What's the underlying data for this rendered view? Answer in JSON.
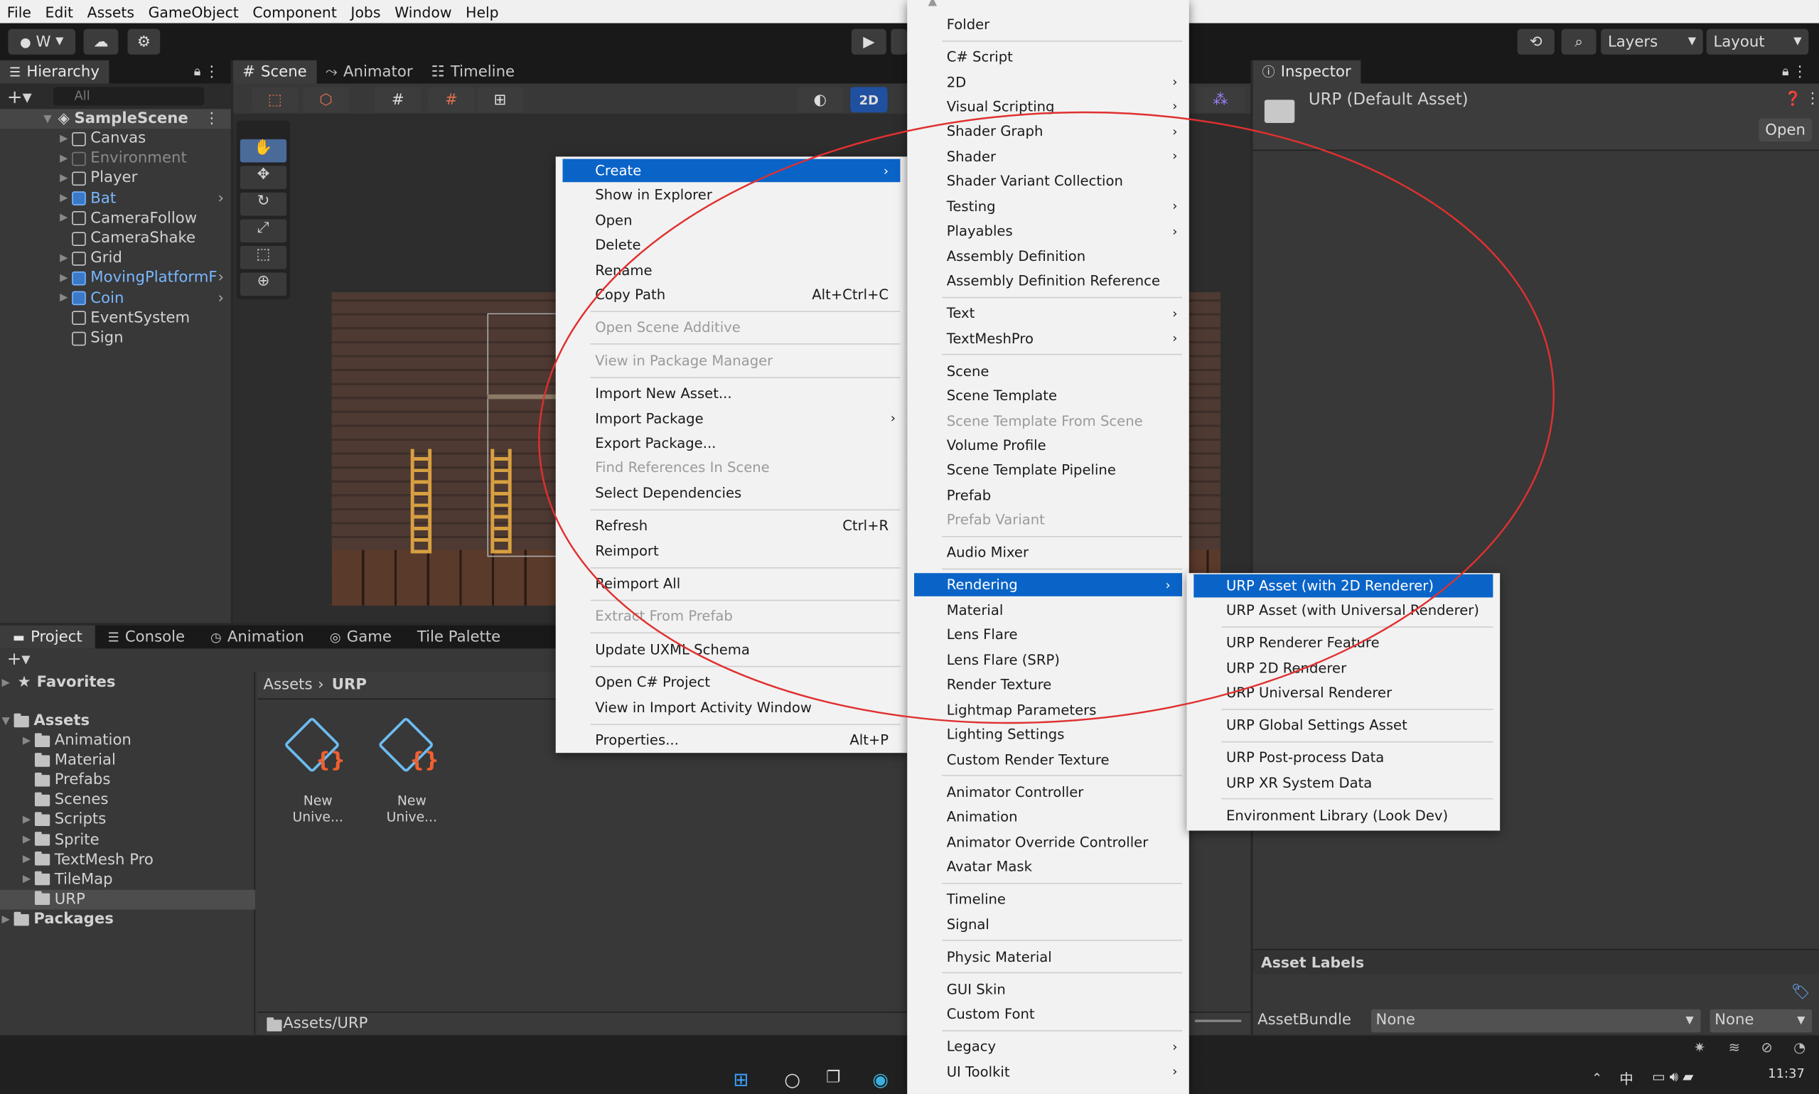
{
  "menubar": [
    "File",
    "Edit",
    "Assets",
    "GameObject",
    "Component",
    "Jobs",
    "Window",
    "Help"
  ],
  "toolbar": {
    "account": "W",
    "layers": "Layers",
    "layout": "Layout"
  },
  "hierarchy": {
    "tab": "Hierarchy",
    "search_placeholder": "All",
    "scene": "SampleScene",
    "items": [
      {
        "label": "Canvas",
        "style": "normal",
        "expand": true
      },
      {
        "label": "Environment",
        "style": "dim",
        "expand": true
      },
      {
        "label": "Player",
        "style": "normal",
        "expand": true
      },
      {
        "label": "Bat",
        "style": "prefab",
        "expand": true,
        "more": true
      },
      {
        "label": "CameraFollow",
        "style": "normal",
        "expand": true
      },
      {
        "label": "CameraShake",
        "style": "normal",
        "expand": false
      },
      {
        "label": "Grid",
        "style": "normal",
        "expand": true
      },
      {
        "label": "MovingPlatformF",
        "style": "prefab",
        "expand": true,
        "more": true
      },
      {
        "label": "Coin",
        "style": "prefab",
        "expand": true,
        "more": true
      },
      {
        "label": "EventSystem",
        "style": "normal",
        "expand": false
      },
      {
        "label": "Sign",
        "style": "normal",
        "expand": false
      }
    ]
  },
  "scene_tabs": [
    "Scene",
    "Animator",
    "Timeline"
  ],
  "scene_toolbar": {
    "mode2d": "2D"
  },
  "bottom_tabs": [
    "Project",
    "Console",
    "Animation",
    "Game",
    "Tile Palette"
  ],
  "project": {
    "favorites": "Favorites",
    "assets": "Assets",
    "folders": [
      "Animation",
      "Material",
      "Prefabs",
      "Scenes",
      "Scripts",
      "Sprite",
      "TextMesh Pro",
      "TileMap",
      "URP"
    ],
    "packages": "Packages",
    "breadcrumb": [
      "Assets",
      "URP"
    ],
    "files": [
      "New Unive...",
      "New Unive..."
    ],
    "footer": "Assets/URP"
  },
  "inspector": {
    "tab": "Inspector",
    "title": "URP (Default Asset)",
    "open": "Open",
    "asset_labels": "Asset Labels",
    "assetbundle": "AssetBundle",
    "ab_value": "None",
    "ab_variant": "None"
  },
  "context_menu": [
    {
      "label": "Create",
      "hl": true,
      "arrow": true
    },
    {
      "label": "Show in Explorer"
    },
    {
      "label": "Open"
    },
    {
      "label": "Delete"
    },
    {
      "label": "Rename"
    },
    {
      "label": "Copy Path",
      "shortcut": "Alt+Ctrl+C"
    },
    {
      "sep": true
    },
    {
      "label": "Open Scene Additive",
      "dis": true
    },
    {
      "sep": true
    },
    {
      "label": "View in Package Manager",
      "dis": true
    },
    {
      "sep": true
    },
    {
      "label": "Import New Asset..."
    },
    {
      "label": "Import Package",
      "arrow": true
    },
    {
      "label": "Export Package..."
    },
    {
      "label": "Find References In Scene",
      "dis": true
    },
    {
      "label": "Select Dependencies"
    },
    {
      "sep": true
    },
    {
      "label": "Refresh",
      "shortcut": "Ctrl+R"
    },
    {
      "label": "Reimport"
    },
    {
      "sep": true
    },
    {
      "label": "Reimport All"
    },
    {
      "sep": true
    },
    {
      "label": "Extract From Prefab",
      "dis": true
    },
    {
      "sep": true
    },
    {
      "label": "Update UXML Schema"
    },
    {
      "sep": true
    },
    {
      "label": "Open C# Project"
    },
    {
      "label": "View in Import Activity Window"
    },
    {
      "sep": true
    },
    {
      "label": "Properties...",
      "shortcut": "Alt+P"
    }
  ],
  "create_menu": [
    {
      "label": "Folder"
    },
    {
      "sep": true
    },
    {
      "label": "C# Script"
    },
    {
      "label": "2D",
      "arrow": true
    },
    {
      "label": "Visual Scripting",
      "arrow": true
    },
    {
      "label": "Shader Graph",
      "arrow": true
    },
    {
      "label": "Shader",
      "arrow": true
    },
    {
      "label": "Shader Variant Collection"
    },
    {
      "label": "Testing",
      "arrow": true
    },
    {
      "label": "Playables",
      "arrow": true
    },
    {
      "label": "Assembly Definition"
    },
    {
      "label": "Assembly Definition Reference"
    },
    {
      "sep": true
    },
    {
      "label": "Text",
      "arrow": true
    },
    {
      "label": "TextMeshPro",
      "arrow": true
    },
    {
      "sep": true
    },
    {
      "label": "Scene"
    },
    {
      "label": "Scene Template"
    },
    {
      "label": "Scene Template From Scene",
      "dis": true
    },
    {
      "label": "Volume Profile"
    },
    {
      "label": "Scene Template Pipeline"
    },
    {
      "label": "Prefab"
    },
    {
      "label": "Prefab Variant",
      "dis": true
    },
    {
      "sep": true
    },
    {
      "label": "Audio Mixer"
    },
    {
      "sep": true
    },
    {
      "label": "Rendering",
      "hl": true,
      "arrow": true
    },
    {
      "label": "Material"
    },
    {
      "label": "Lens Flare"
    },
    {
      "label": "Lens Flare (SRP)"
    },
    {
      "label": "Render Texture"
    },
    {
      "label": "Lightmap Parameters"
    },
    {
      "label": "Lighting Settings"
    },
    {
      "label": "Custom Render Texture"
    },
    {
      "sep": true
    },
    {
      "label": "Animator Controller"
    },
    {
      "label": "Animation"
    },
    {
      "label": "Animator Override Controller"
    },
    {
      "label": "Avatar Mask"
    },
    {
      "sep": true
    },
    {
      "label": "Timeline"
    },
    {
      "label": "Signal"
    },
    {
      "sep": true
    },
    {
      "label": "Physic Material"
    },
    {
      "sep": true
    },
    {
      "label": "GUI Skin"
    },
    {
      "label": "Custom Font"
    },
    {
      "sep": true
    },
    {
      "label": "Legacy",
      "arrow": true
    },
    {
      "label": "UI Toolkit",
      "arrow": true
    }
  ],
  "rendering_menu": [
    {
      "label": "URP Asset (with 2D Renderer)",
      "hl": true
    },
    {
      "label": "URP Asset (with Universal Renderer)"
    },
    {
      "sep": true
    },
    {
      "label": "URP Renderer Feature"
    },
    {
      "label": "URP 2D Renderer"
    },
    {
      "label": "URP Universal Renderer"
    },
    {
      "sep": true
    },
    {
      "label": "URP Global Settings Asset"
    },
    {
      "sep": true
    },
    {
      "label": "URP Post-process Data"
    },
    {
      "label": "URP XR System Data"
    },
    {
      "sep": true
    },
    {
      "label": "Environment Library (Look Dev)"
    }
  ],
  "taskbar": {
    "ime": "中",
    "time": "11:37"
  },
  "colors": {
    "highlight": "#0a64c8",
    "annotation": "#e03030",
    "prefab": "#7ab7ff"
  }
}
